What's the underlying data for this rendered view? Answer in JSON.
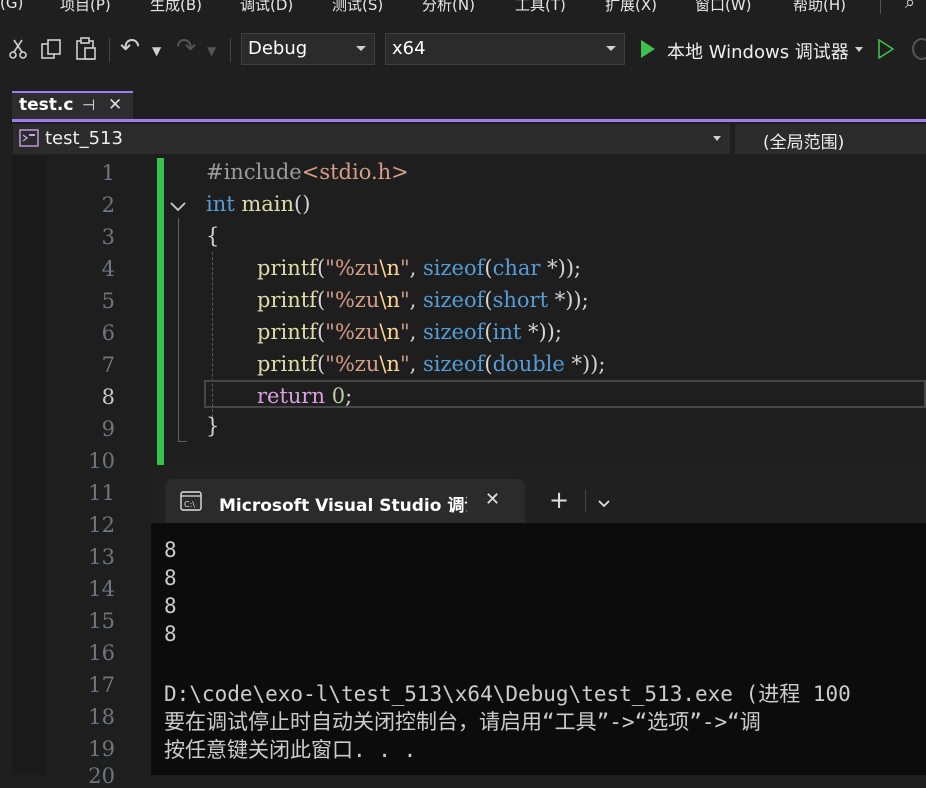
{
  "menu": {
    "items": [
      "(G)",
      "项目(P)",
      "生成(B)",
      "调试(D)",
      "测试(S)",
      "分析(N)",
      "工具(T)",
      "扩展(X)",
      "窗口(W)",
      "帮助(H)"
    ]
  },
  "toolbar": {
    "configuration": "Debug",
    "platform": "x64",
    "run_label": "本地 Windows 调试器"
  },
  "tab": {
    "filename": "test.c",
    "pin_glyph": "⊣",
    "close_glyph": "✕"
  },
  "navbar": {
    "project": "test_513",
    "scope": "(全局范围)"
  },
  "editor": {
    "line_numbers": [
      "1",
      "2",
      "3",
      "4",
      "5",
      "6",
      "7",
      "8",
      "9",
      "10",
      "11",
      "12",
      "13",
      "14",
      "15",
      "16",
      "17",
      "18",
      "19",
      "20"
    ],
    "current_line": "8",
    "code": {
      "l1_directive": "#include",
      "l1_header": "<stdio.h>",
      "l2_type": "int",
      "l2_name": " main",
      "l2_parens": "()",
      "l3": "{",
      "printf": "printf",
      "open_paren": "(",
      "quote_open": "\"",
      "fmt": "%zu",
      "newline_esc": "\\n",
      "quote_close": "\"",
      "comma": ", ",
      "sizeof": "sizeof",
      "type_char": "char",
      "type_short": "short",
      "type_int": "int",
      "type_double": "double",
      "ptr_tail": " *));",
      "return_kw": "return",
      "return_val": "0",
      "semicolon": ";",
      "close_brace": "}"
    }
  },
  "console": {
    "title": "Microsoft Visual Studio 调试控",
    "close_glyph": "✕",
    "new_tab_glyph": "+",
    "dropdown_glyph": "⌵",
    "output_lines": [
      "8",
      "8",
      "8",
      "8"
    ],
    "exit_line": "D:\\code\\exo-l\\test_513\\x64\\Debug\\test_513.exe (进程 100",
    "hint_line": "要在调试停止时自动关闭控制台，请启用“工具”->“选项”->“调",
    "press_line": "按任意键关闭此窗口. . ."
  },
  "colors": {
    "accent": "#9d7df0",
    "change_bar": "#37c24b",
    "run_green": "#3fbf4c"
  }
}
